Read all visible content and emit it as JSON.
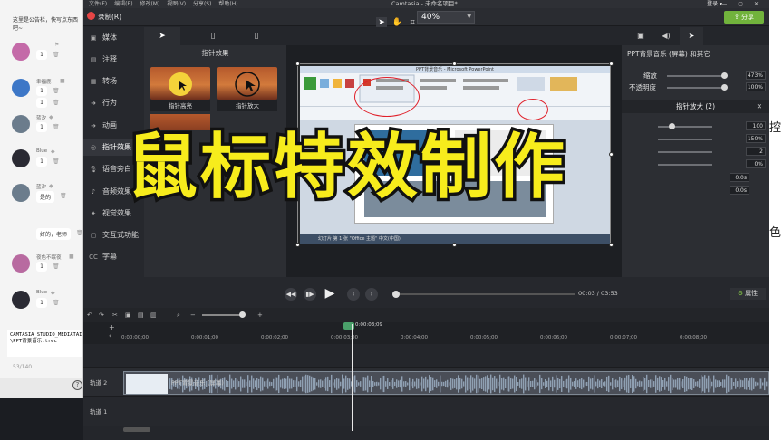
{
  "chat": {
    "top_message": "这里是公告栏，快写点东西吧~",
    "rows": [
      {
        "name": "",
        "bubble": "1"
      },
      {
        "name": "幸福鹿",
        "bubble": "1"
      },
      {
        "name": "",
        "bubble": "1"
      },
      {
        "name": "蓝汐",
        "bubble": "1"
      },
      {
        "name": "Blue",
        "bubble": "1"
      },
      {
        "name": "蓝汐",
        "bubble": "是的"
      },
      {
        "name": "",
        "bubble": "好的，老师"
      },
      {
        "name": "夜色不眠夜",
        "bubble": "1"
      },
      {
        "name": "Blue",
        "bubble": "1"
      }
    ],
    "input_line1": "CAMTASIA_STUDIO_MEDIATAIN",
    "input_line2": "\\PPT背景音乐.trec",
    "counter": "53/140"
  },
  "camtasia": {
    "menu": [
      "文件(F)",
      "编辑(E)",
      "修改(M)",
      "视图(V)",
      "分享(S)",
      "帮助(H)"
    ],
    "window_title": "Camtasia - 未命名项目*",
    "login": "登录 ▾",
    "record_label": "录制(R)",
    "zoom": "40%",
    "share_label": "分享",
    "tools": [
      {
        "label": "媒体",
        "icon": "▣"
      },
      {
        "label": "注释",
        "icon": "▤"
      },
      {
        "label": "转场",
        "icon": "▦"
      },
      {
        "label": "行为",
        "icon": "➜"
      },
      {
        "label": "动画",
        "icon": "➔"
      },
      {
        "label": "指针效果",
        "icon": "◎"
      },
      {
        "label": "语音旁白",
        "icon": "🎙"
      },
      {
        "label": "音频效果",
        "icon": "♪"
      },
      {
        "label": "视觉效果",
        "icon": "✦"
      },
      {
        "label": "交互式功能",
        "icon": "▢"
      },
      {
        "label": "字幕",
        "icon": "CC"
      }
    ],
    "effects": {
      "header": "指针效果",
      "items": [
        "指针高亮",
        "指针放大"
      ]
    },
    "properties": {
      "title": "PPT背景音乐 (屏幕) 和其它",
      "scale_label": "缩放",
      "scale_value": "473%",
      "opacity_label": "不透明度",
      "opacity_value": "100%",
      "section_title": "指针放大 (2)",
      "section_values": [
        "100",
        "150%",
        "2",
        "0%",
        "0.0s",
        "0.0s"
      ],
      "button_label": "属性"
    },
    "playback": {
      "time": "00:03 / 03:53"
    },
    "timeline": {
      "playhead_time": "0:00:03;09",
      "ticks": [
        "0:00:00;00",
        "0:00:01;00",
        "0:00:02;00",
        "0:00:03;00",
        "0:00:04;00",
        "0:00:05;00",
        "0:00:06;00",
        "0:00:07;00",
        "0:00:08;00"
      ],
      "track2_label": "轨道 2",
      "track1_label": "轨道 1",
      "clip_title": "PPT背景音乐 (屏幕)"
    },
    "ppt": {
      "title": "PPT背景音乐 - Microsoft PowerPoint",
      "status": "幻灯片 第 1 张   \"Office 主题\"   中文(中国)"
    }
  },
  "right_strip": [
    "控",
    "色"
  ],
  "overlay_title": "鼠标特效制作",
  "colors": {
    "accent_green": "#71b33c",
    "record_red": "#e64545",
    "overlay_yellow": "#f7ec1c"
  }
}
